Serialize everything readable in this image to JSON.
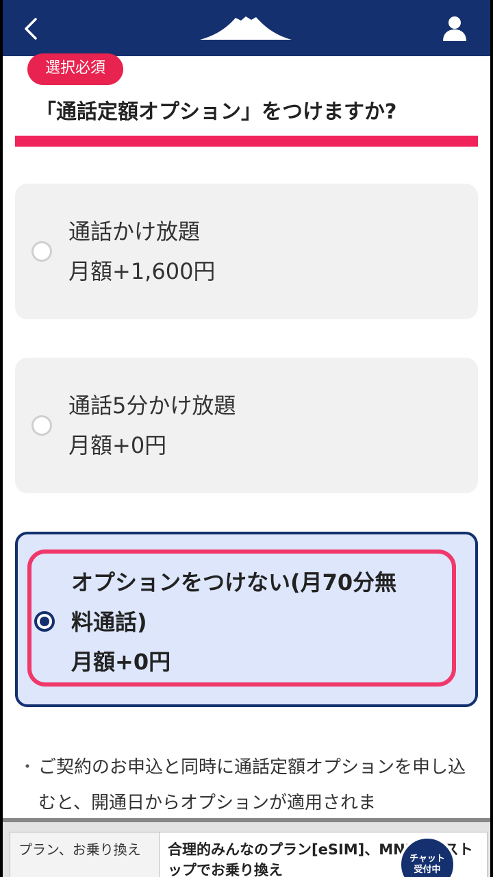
{
  "header": {
    "back_icon": "chevron-left-icon",
    "logo_icon": "mountain-logo-icon",
    "user_icon": "user-icon",
    "color": "#14306e"
  },
  "badge": "選択必須",
  "title": "「通話定額オプション」をつけますか?",
  "options": [
    {
      "line1": "通話かけ放題",
      "line2": "月額+1,600円",
      "selected": false
    },
    {
      "line1": "通話5分かけ放題",
      "line2": "月額+0円",
      "selected": false
    },
    {
      "line1a": "オプションをつけない(月70分無",
      "line1b": "料通話)",
      "line2": "月額+0円",
      "selected": true
    }
  ],
  "note": {
    "bullet": "・",
    "text": "ご契約のお申込と同時に通話定額オプションを申し込むと、開通日からオプションが適用されま"
  },
  "footer": {
    "label": "プラン、お乗り換え",
    "value": "合理的みんなのプラン[eSIM]、MNPワンストップでお乗り換え"
  },
  "chat": {
    "line1": "チャット",
    "line2": "受付中"
  },
  "colors": {
    "accent": "#e8234f",
    "navy": "#14306e",
    "highlight": "#f0386a"
  }
}
